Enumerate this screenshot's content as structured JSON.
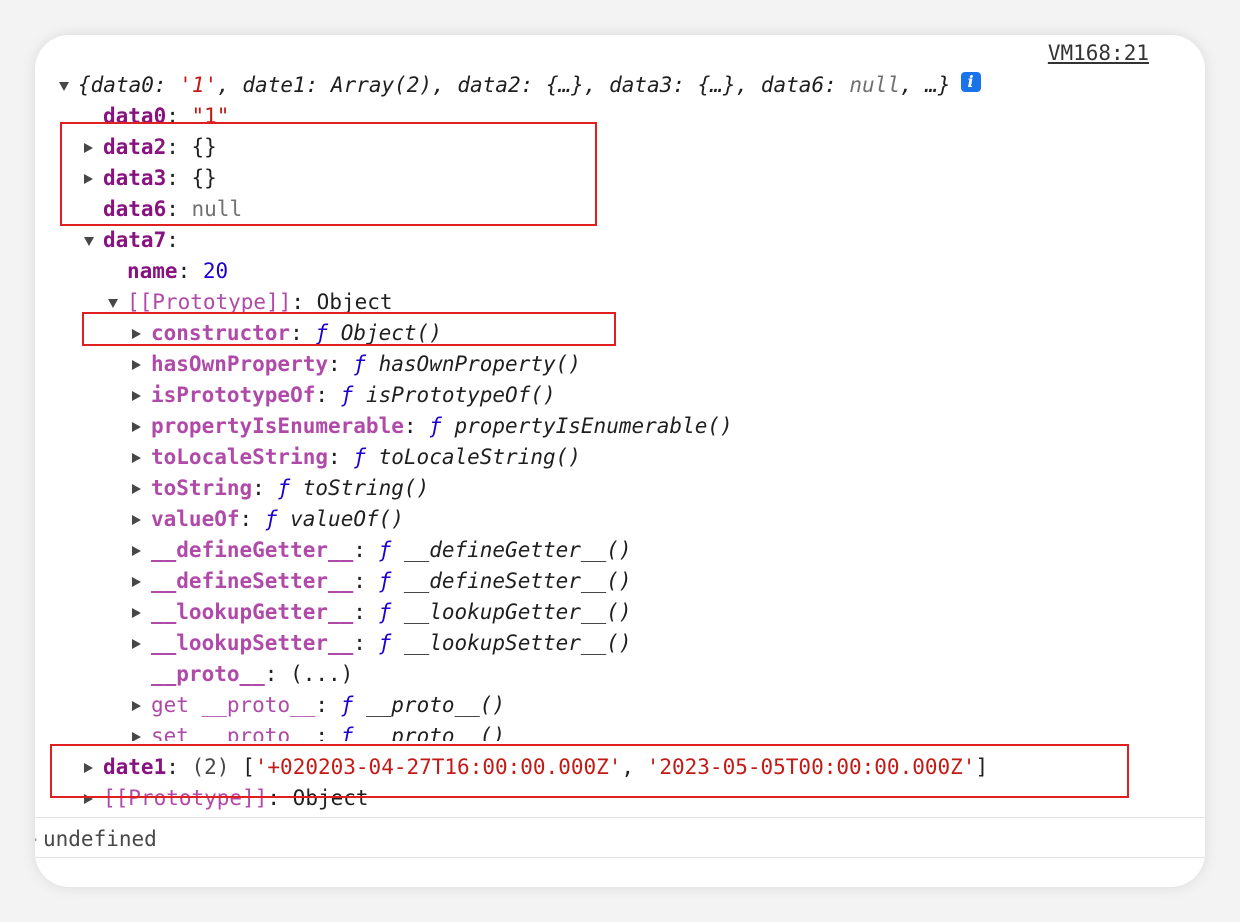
{
  "source_link": "VM168:21",
  "summary": {
    "open": "{",
    "k0": "data0",
    "v0": "'1'",
    "k1": "date1",
    "v1": "Array(2)",
    "k2": "data2",
    "v2": "{…}",
    "k3": "data3",
    "v3": "{…}",
    "k6": "data6",
    "v6": "null",
    "tail": "…}"
  },
  "entries": {
    "data0": {
      "key": "data0",
      "value": "\"1\""
    },
    "data2": {
      "key": "data2",
      "value": "{}"
    },
    "data3": {
      "key": "data3",
      "value": "{}"
    },
    "data6": {
      "key": "data6",
      "value": "null"
    },
    "data7": {
      "key": "data7"
    },
    "name": {
      "key": "name",
      "value": "20"
    },
    "prototype_obj": {
      "key": "[[Prototype]]",
      "value": "Object"
    }
  },
  "proto_members": [
    {
      "key": "constructor",
      "fn": "Object()"
    },
    {
      "key": "hasOwnProperty",
      "fn": "hasOwnProperty()"
    },
    {
      "key": "isPrototypeOf",
      "fn": "isPrototypeOf()"
    },
    {
      "key": "propertyIsEnumerable",
      "fn": "propertyIsEnumerable()"
    },
    {
      "key": "toLocaleString",
      "fn": "toLocaleString()"
    },
    {
      "key": "toString",
      "fn": "toString()"
    },
    {
      "key": "valueOf",
      "fn": "valueOf()"
    },
    {
      "key": "__defineGetter__",
      "fn": "__defineGetter__()"
    },
    {
      "key": "__defineSetter__",
      "fn": "__defineSetter__()"
    },
    {
      "key": "__lookupGetter__",
      "fn": "__lookupGetter__()"
    },
    {
      "key": "__lookupSetter__",
      "fn": "__lookupSetter__()"
    }
  ],
  "proto_accessor": {
    "key": "__proto__",
    "value": "(...)"
  },
  "get_proto": {
    "prefix": "get",
    "key": "__proto__",
    "fn": "__proto__()"
  },
  "set_proto": {
    "prefix": "set",
    "key": "__proto__",
    "fn": "__proto__()"
  },
  "func_symbol": "ƒ",
  "date1": {
    "key": "date1",
    "count": "(2)",
    "item0": "'+020203-04-27T16:00:00.000Z'",
    "item1": "'2023-05-05T00:00:00.000Z'"
  },
  "root_prototype": {
    "key": "[[Prototype]]",
    "value": "Object"
  },
  "result": "undefined",
  "colors": {
    "highlight_box": "#e02020",
    "info_icon": "#1a73e8",
    "key": "#881280",
    "string": "#c41a16",
    "number": "#1c00cf"
  }
}
